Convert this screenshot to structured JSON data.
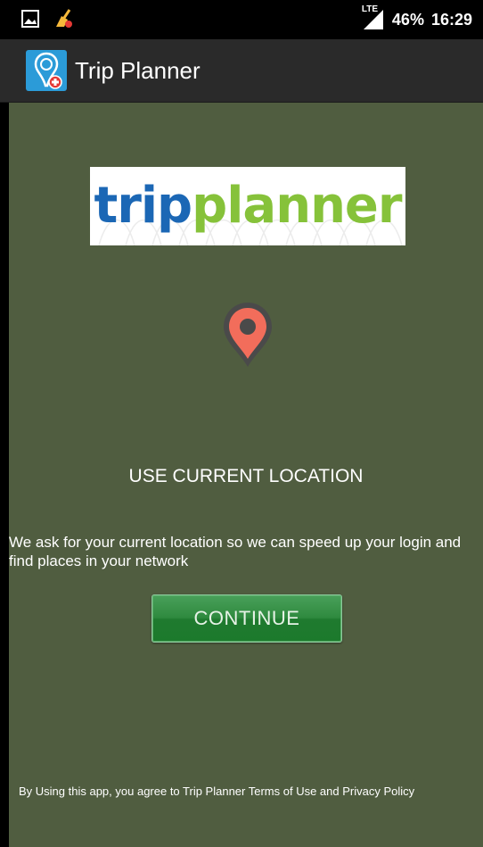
{
  "status_bar": {
    "network": "LTE",
    "battery": "46%",
    "time": "16:29",
    "icons": [
      "image-icon",
      "cleaner-icon",
      "signal-icon"
    ]
  },
  "app_bar": {
    "title": "Trip Planner",
    "logo_icon": "trip-planner-logo-icon",
    "background": "#2a2a2a"
  },
  "main": {
    "brand_logo": {
      "part1": "trip",
      "part2": "planner",
      "color1": "#1b67b5",
      "color2": "#86c23a"
    },
    "location_icon": "location-pin-icon",
    "heading": "USE CURRENT LOCATION",
    "message": "We ask for your current location so we can speed up your login and find places in your network",
    "continue_label": "CONTINUE",
    "terms": "By Using this app, you agree to Trip Planner Terms of Use and Privacy Policy",
    "background": "#505d40",
    "accent": "#2f8a3f",
    "pin_color": "#f26d5b"
  }
}
